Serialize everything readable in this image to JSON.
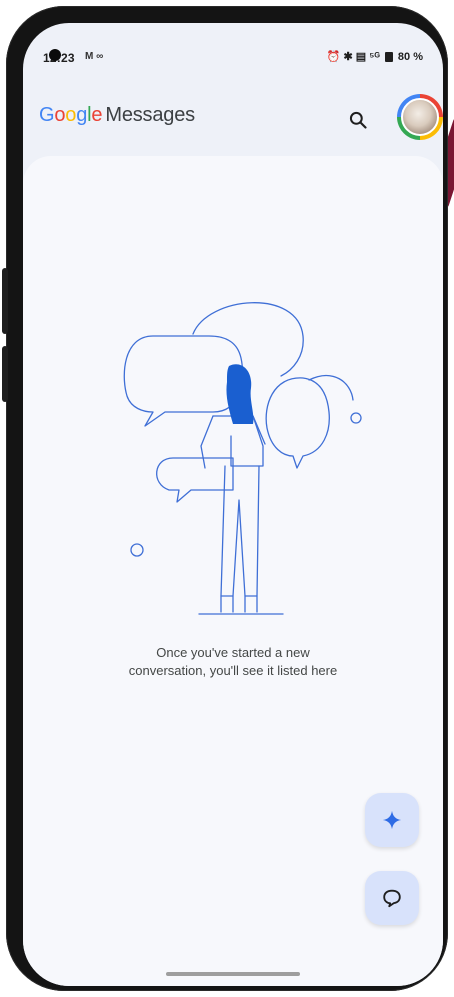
{
  "status_bar": {
    "time": "12:23",
    "left_icons": "M ∞",
    "right_icons_text": "⏰ ✱ ▤ ⁵ᴳ",
    "battery": "80 %"
  },
  "app_bar": {
    "logo_letters": [
      "G",
      "o",
      "o",
      "g",
      "l",
      "e"
    ],
    "logo_suffix": "Messages",
    "search_icon": "search-icon",
    "avatar": "profile-avatar"
  },
  "empty_state": {
    "line1": "Once you've started a new",
    "line2": "conversation, you'll see it listed here"
  },
  "fabs": {
    "sparkle": "sparkle-icon",
    "new_chat": "chat-bubble-icon"
  },
  "colors": {
    "google_blue": "#4285f4",
    "google_red": "#ea4335",
    "google_yellow": "#fbbc05",
    "google_green": "#34a853",
    "fab_bg": "#d8e2fb",
    "accent": "#1a73e8"
  }
}
